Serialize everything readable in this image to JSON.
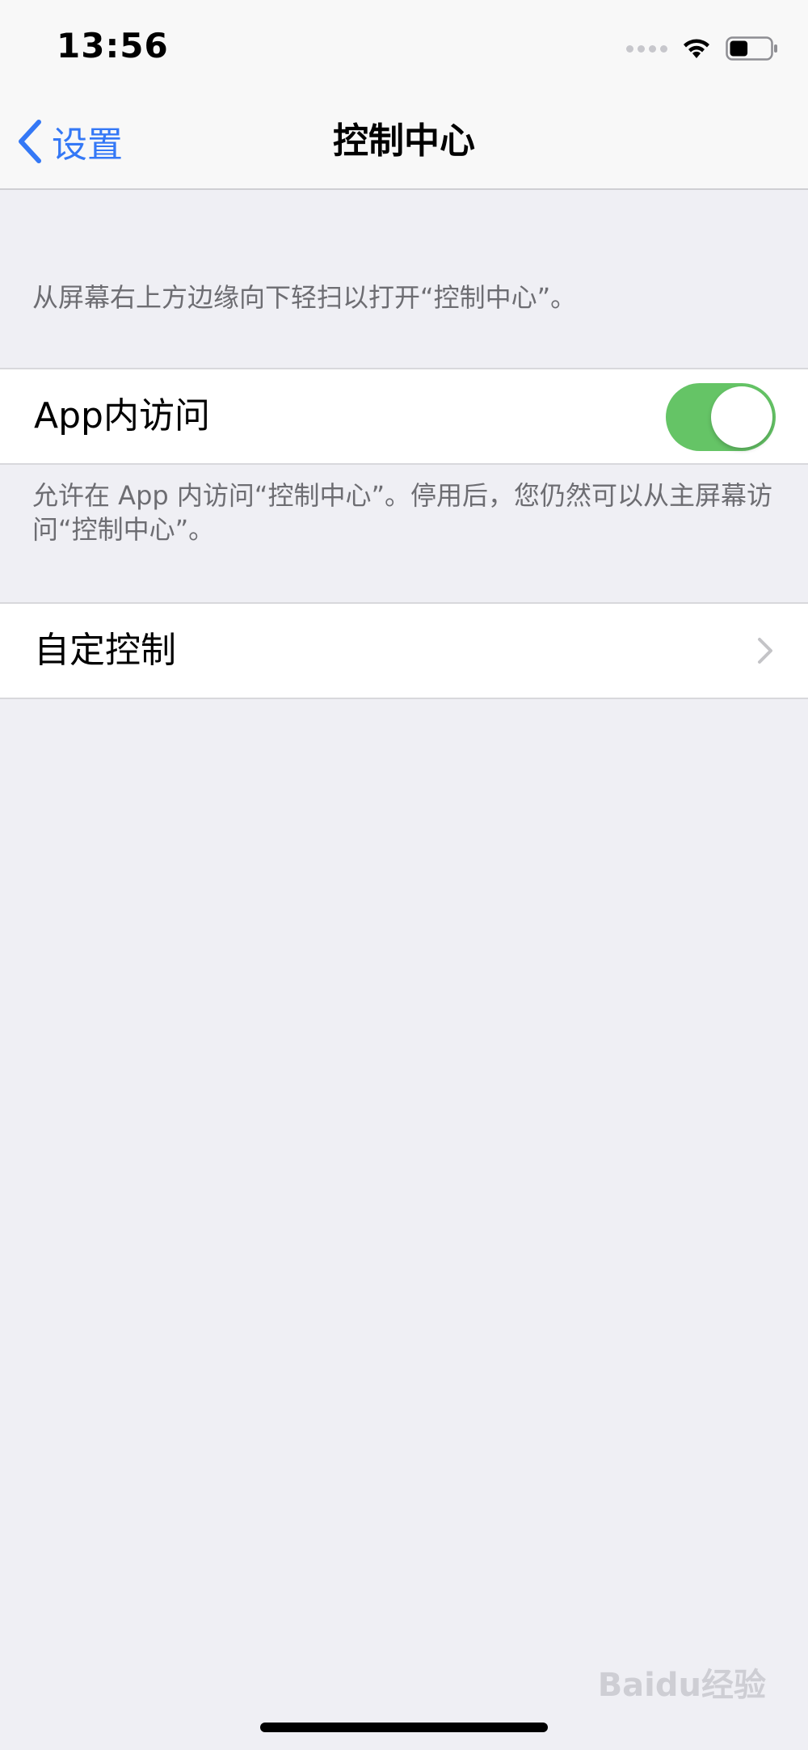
{
  "status_bar": {
    "time": "13:56",
    "signal_icon": "signal-dots-icon",
    "wifi_icon": "wifi-icon",
    "battery_icon": "battery-icon",
    "battery_level": 0.45
  },
  "nav": {
    "back_label": "设置",
    "back_icon": "chevron-left-icon",
    "title": "控制中心",
    "accent_color": "#3478f6"
  },
  "hint_top": "从屏幕右上方边缘向下轻扫以打开“控制中心”。",
  "app_access": {
    "label": "App内访问",
    "toggle_on": true,
    "toggle_color": "#65c466",
    "footer": "允许在 App 内访问“控制中心”。停用后，您仍然可以从主屏幕访问“控制中心”。"
  },
  "customize": {
    "label": "自定控制",
    "icon": "chevron-right-icon"
  },
  "watermark": "Baidu经验"
}
